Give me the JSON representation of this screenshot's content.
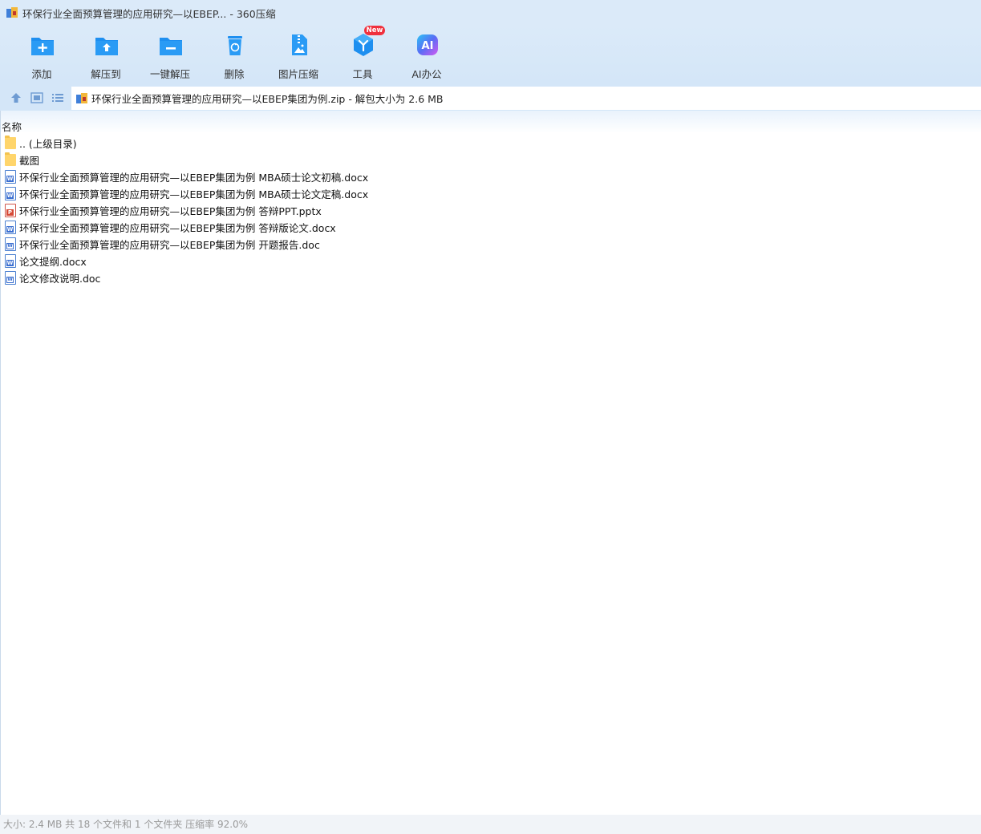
{
  "window": {
    "title": "环保行业全面预算管理的应用研究—以EBEP... - 360压缩"
  },
  "toolbar": {
    "buttons": [
      {
        "label": "添加",
        "icon": "add-folder-icon"
      },
      {
        "label": "解压到",
        "icon": "extract-to-icon"
      },
      {
        "label": "一键解压",
        "icon": "one-click-extract-icon"
      },
      {
        "label": "删除",
        "icon": "delete-icon"
      },
      {
        "label": "图片压缩",
        "icon": "image-compress-icon"
      },
      {
        "label": "工具",
        "icon": "tools-icon"
      },
      {
        "label": "AI办公",
        "icon": "ai-office-icon"
      }
    ],
    "badge": "New"
  },
  "address": {
    "path": "环保行业全面预算管理的应用研究—以EBEP集团为例.zip - 解包大小为 2.6 MB"
  },
  "list": {
    "header": "名称",
    "items": [
      {
        "name": ".. (上级目录)",
        "type": "folder"
      },
      {
        "name": "截图",
        "type": "folder"
      },
      {
        "name": "环保行业全面预算管理的应用研究—以EBEP集团为例 MBA硕士论文初稿.docx",
        "type": "docx"
      },
      {
        "name": "环保行业全面预算管理的应用研究—以EBEP集团为例 MBA硕士论文定稿.docx",
        "type": "docx"
      },
      {
        "name": "环保行业全面预算管理的应用研究—以EBEP集团为例 答辩PPT.pptx",
        "type": "pptx"
      },
      {
        "name": "环保行业全面预算管理的应用研究—以EBEP集团为例 答辩版论文.docx",
        "type": "docx"
      },
      {
        "name": "环保行业全面预算管理的应用研究—以EBEP集团为例 开题报告.doc",
        "type": "doc"
      },
      {
        "name": "论文提纲.docx",
        "type": "docx"
      },
      {
        "name": "论文修改说明.doc",
        "type": "doc"
      }
    ]
  },
  "status": {
    "text": "大小: 2.4 MB 共 18 个文件和 1 个文件夹 压缩率 92.0%"
  },
  "colors": {
    "accent": "#1e8ff0",
    "toolbar_bg": "#d4e6f8",
    "badge": "#f0303d"
  }
}
